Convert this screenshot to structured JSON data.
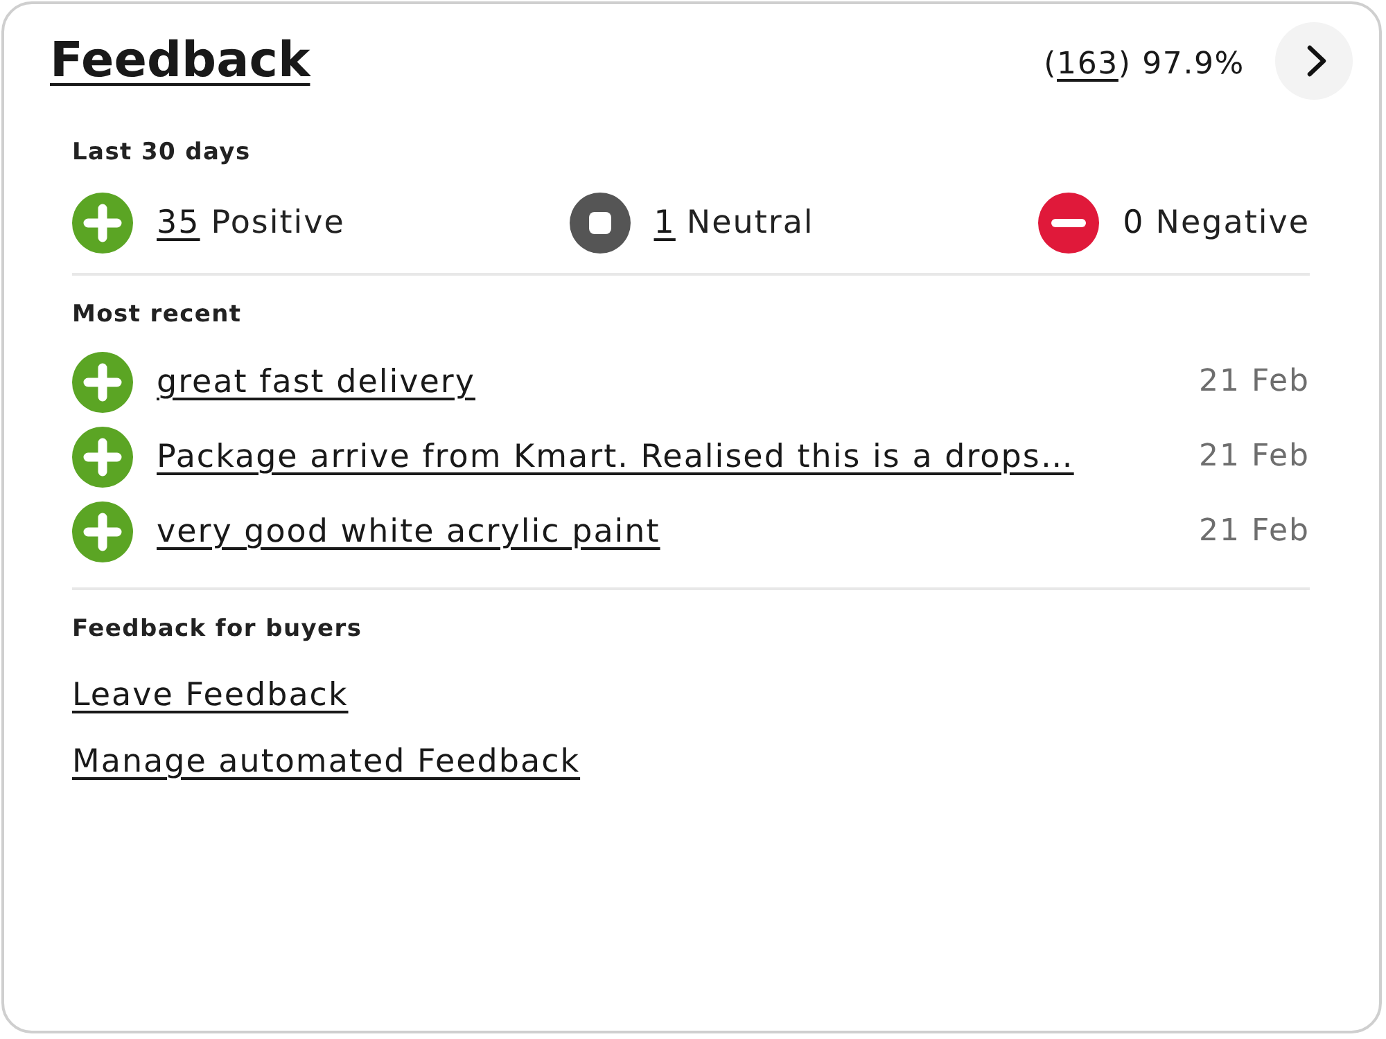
{
  "card": {
    "title": "Feedback",
    "rating": {
      "before": "(",
      "count": "163",
      "after": ") 97.9%"
    }
  },
  "last_30_days": {
    "heading": "Last 30 days",
    "items": [
      {
        "kind": "positive",
        "count": "35",
        "linked": true,
        "label": "Positive"
      },
      {
        "kind": "neutral",
        "count": "1",
        "linked": true,
        "label": "Neutral"
      },
      {
        "kind": "negative",
        "count": "0",
        "linked": false,
        "label": "Negative"
      }
    ]
  },
  "most_recent": {
    "heading": "Most recent",
    "items": [
      {
        "kind": "positive",
        "comment": "great fast delivery",
        "date": "21 Feb"
      },
      {
        "kind": "positive",
        "comment": "Package arrive from Kmart. Realised this is a drops…",
        "date": "21 Feb"
      },
      {
        "kind": "positive",
        "comment": "very good white acrylic paint",
        "date": "21 Feb"
      }
    ]
  },
  "feedback_for_buyers": {
    "heading": "Feedback for buyers",
    "links": [
      "Leave Feedback",
      "Manage automated Feedback"
    ]
  }
}
